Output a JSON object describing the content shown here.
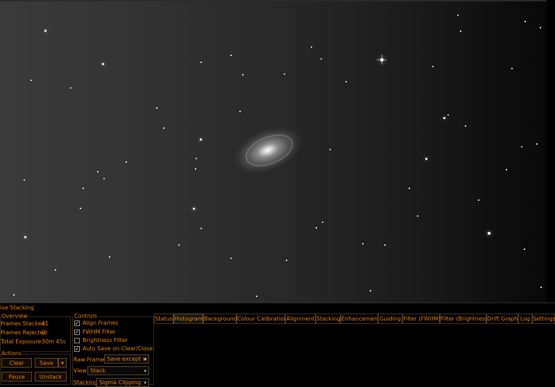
{
  "panel": {
    "title": "ive Stacking"
  },
  "overview": {
    "legend": "Overview",
    "frames_stacked_label": "Frames Stacked:",
    "frames_stacked_value": "41",
    "frames_rejected_label": "Frames Rejected:",
    "frames_rejected_value": "0",
    "total_exposure_label": "Total Exposure:",
    "total_exposure_value": "30m 45s"
  },
  "actions": {
    "legend": "Actions",
    "clear_label": "Clear",
    "save_label": "Save",
    "pause_label": "Pause",
    "unstack_label": "Unstack"
  },
  "controls": {
    "legend": "Controls",
    "align_frames": "Align Frames",
    "fwhm_filter": "FWHM Filter",
    "brightness_filter": "Brightness Filter",
    "auto_save": "Auto Save on Clear/Close",
    "raw_frames_label": "Raw Frames",
    "raw_frames_value": "Save except w",
    "view_label": "View",
    "view_value": "Stack",
    "stacking_label": "Stacking",
    "stacking_value": "Sigma Clipping"
  },
  "tabs": [
    "Status",
    "Histogram",
    "Background",
    "Colour Calibration",
    "Alignment",
    "Stacking",
    "Enhancement",
    "Guiding",
    "Filter (FWHM)",
    "Filter (Brightness)",
    "Drift Graph",
    "Log",
    "Settings"
  ],
  "active_tab": "Histogram",
  "colors": {
    "accent": "#e8820c",
    "background": "#000000"
  }
}
